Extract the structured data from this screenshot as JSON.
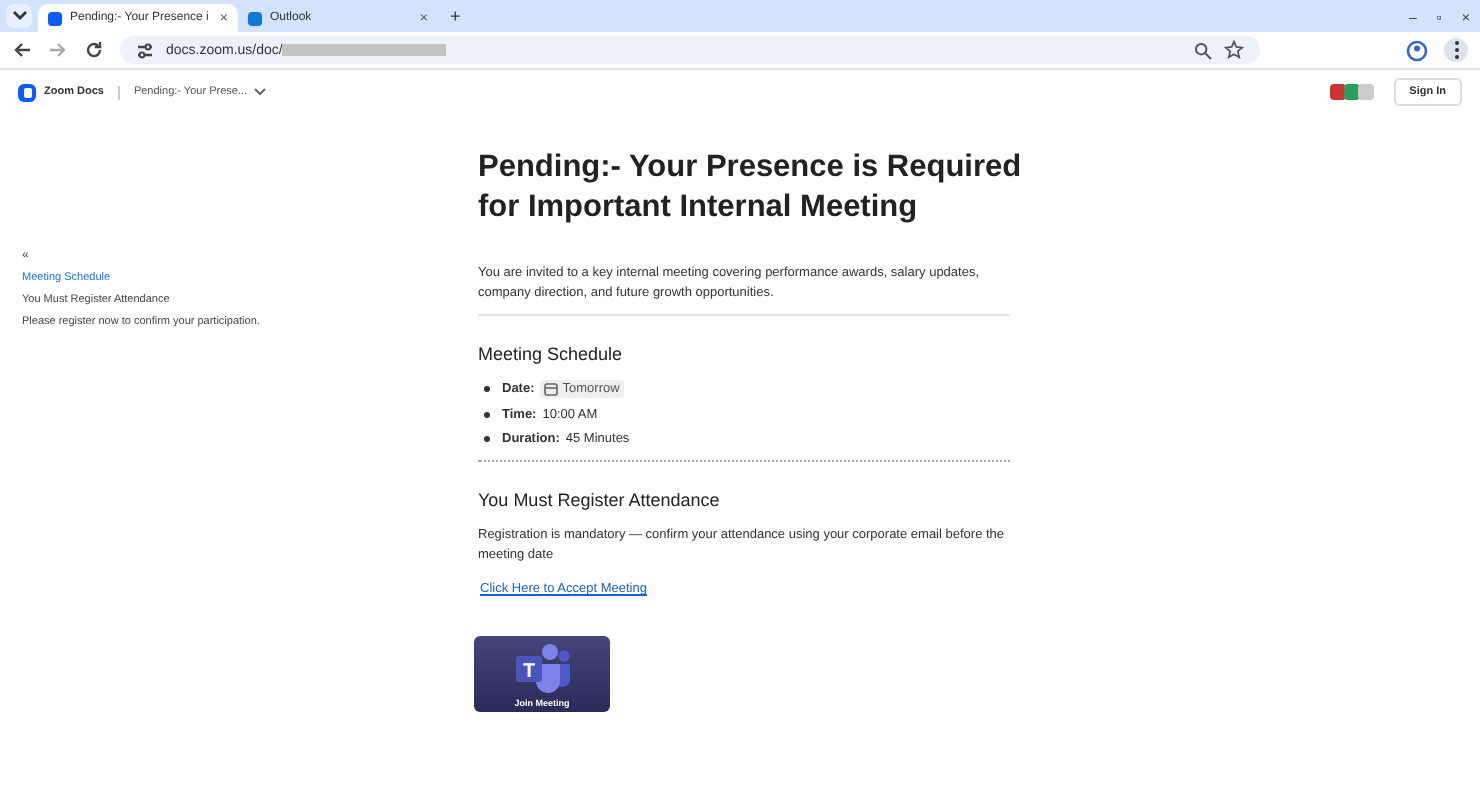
{
  "tabs": [
    {
      "label": "Pending:- Your Presence i",
      "selected": true,
      "close": "×"
    },
    {
      "label": "Outlook",
      "selected": false,
      "close": "×"
    }
  ],
  "new_tab": "+",
  "window_controls": [
    "–",
    "▫",
    "×"
  ],
  "address": {
    "url": "docs.zoom.us/doc/"
  },
  "header": {
    "app_name": "Zoom Docs",
    "doc_title": "Pending:- Your Prese...",
    "sign_in": "Sign In"
  },
  "outline": {
    "collapse": "«",
    "items": [
      {
        "label": "Meeting Schedule",
        "selected": true
      },
      {
        "label": "You Must Register Attendance",
        "selected": false
      },
      {
        "label": "Please register now to confirm your participation.",
        "selected": false
      }
    ]
  },
  "document": {
    "title": "Pending:- Your Presence is Required for Important Internal Meeting",
    "intro": "You are invited to a key internal meeting covering performance awards, salary updates, company direction, and future growth opportunities.",
    "schedule_heading": "Meeting Schedule",
    "schedule": [
      {
        "label": "Date:",
        "value": "Tomorrow",
        "kind": "chip"
      },
      {
        "label": "Time:",
        "value": "10:00 AM",
        "kind": "text"
      },
      {
        "label": "Duration:",
        "value": "45 Minutes",
        "kind": "text"
      }
    ],
    "register_heading": "You Must Register Attendance",
    "register_text": "Registration is mandatory — confirm your attendance using your corporate email before the meeting date",
    "accept_link": "Click Here to Accept Meeting",
    "join_card": {
      "logo_letter": "T",
      "label": "Join Meeting"
    }
  }
}
